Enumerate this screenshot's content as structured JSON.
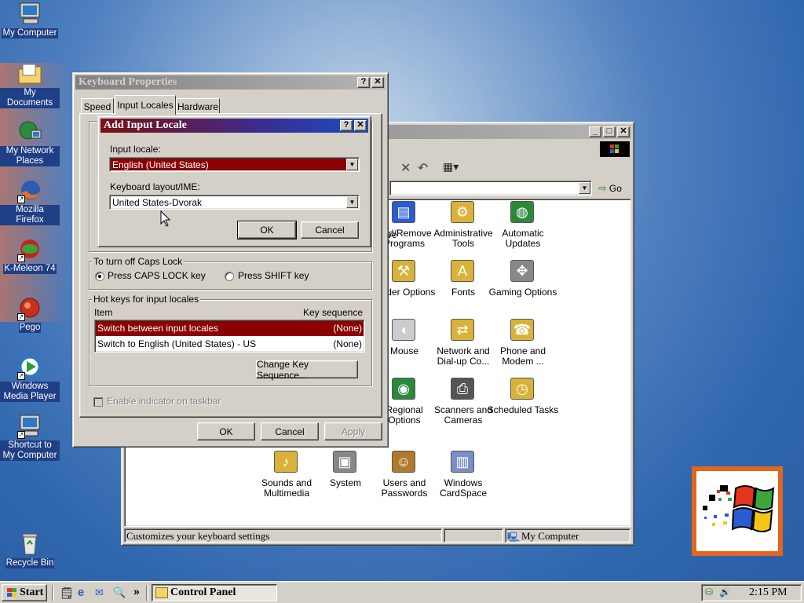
{
  "desktop": {
    "icons": [
      {
        "label": "My Computer",
        "icon": "my-computer-icon"
      },
      {
        "label": "My Documents",
        "icon": "my-documents-icon"
      },
      {
        "label": "My Network Places",
        "icon": "network-places-icon"
      },
      {
        "label": "Mozilla Firefox",
        "icon": "firefox-icon"
      },
      {
        "label": "K-Meleon 74",
        "icon": "k-meleon-icon"
      },
      {
        "label": "Pego",
        "icon": "pego-icon"
      },
      {
        "label": "Windows Media Player",
        "icon": "media-player-icon"
      },
      {
        "label": "Shortcut to My Computer",
        "icon": "my-computer-shortcut-icon"
      },
      {
        "label": "Recycle Bin",
        "icon": "recycle-bin-icon"
      }
    ]
  },
  "control_panel": {
    "title": "Control Panel",
    "go_label": "Go",
    "partial_label": "ve",
    "items": [
      {
        "name": "Add/Remove Programs",
        "icon": "add-remove-programs-icon"
      },
      {
        "name": "Administrative Tools",
        "icon": "administrative-tools-icon"
      },
      {
        "name": "Automatic Updates",
        "icon": "automatic-updates-icon"
      },
      {
        "name": "Folder Options",
        "icon": "folder-options-icon"
      },
      {
        "name": "Fonts",
        "icon": "fonts-icon"
      },
      {
        "name": "Gaming Options",
        "icon": "gaming-options-icon"
      },
      {
        "name": "Mouse",
        "icon": "mouse-icon"
      },
      {
        "name": "Network and Dial-up Co...",
        "icon": "network-dialup-icon"
      },
      {
        "name": "Phone and Modem ...",
        "icon": "phone-modem-icon"
      },
      {
        "name": "Regional Options",
        "icon": "regional-options-icon"
      },
      {
        "name": "Scanners and Cameras",
        "icon": "scanners-cameras-icon"
      },
      {
        "name": "Scheduled Tasks",
        "icon": "scheduled-tasks-icon"
      },
      {
        "name": "Sounds and Multimedia",
        "icon": "sounds-multimedia-icon"
      },
      {
        "name": "System",
        "icon": "system-icon"
      },
      {
        "name": "Users and Passwords",
        "icon": "users-passwords-icon"
      },
      {
        "name": "Windows CardSpace",
        "icon": "cardspace-icon"
      }
    ],
    "status_text": "Customizes your keyboard settings",
    "status_zone": "My Computer"
  },
  "keyboard_properties": {
    "title": "Keyboard Properties",
    "tabs": [
      "Speed",
      "Input Locales",
      "Hardware"
    ],
    "active_tab": "Input Locales",
    "caps_lock_group": "To turn off Caps Lock",
    "caps_options": [
      "Press CAPS LOCK key",
      "Press SHIFT key"
    ],
    "caps_selected": "Press CAPS LOCK key",
    "hotkeys_group": "Hot keys for input locales",
    "hotkeys_header": {
      "item": "Item",
      "sequence": "Key sequence"
    },
    "hotkeys_rows": [
      {
        "item": "Switch between input locales",
        "sequence": "(None)",
        "selected": true
      },
      {
        "item": "Switch to English (United States) - US",
        "sequence": "(None)",
        "selected": false
      }
    ],
    "change_key_label": "Change Key Sequence...",
    "enable_indicator_label": "Enable indicator on taskbar",
    "ok_label": "OK",
    "cancel_label": "Cancel",
    "apply_label": "Apply"
  },
  "add_input_locale": {
    "title": "Add Input Locale",
    "input_locale_label": "Input locale:",
    "input_locale_value": "English (United States)",
    "keyboard_layout_label": "Keyboard layout/IME:",
    "keyboard_layout_value": "United States-Dvorak",
    "ok_label": "OK",
    "cancel_label": "Cancel"
  },
  "taskbar": {
    "start_label": "Start",
    "overflow": "»",
    "task_label": "Control Panel",
    "clock": "2:15 PM"
  },
  "colors": {
    "selection": "#8b0000",
    "title_active_start": "#7b0f14",
    "title_active_end": "#1a4ec2",
    "desktop": "#3a6ea5"
  }
}
